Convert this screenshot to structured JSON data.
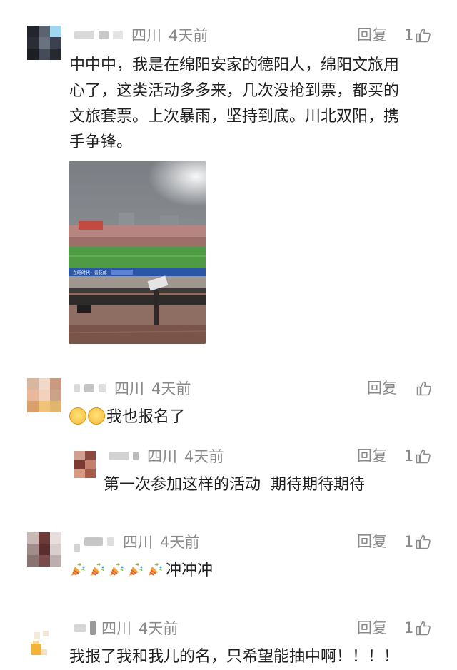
{
  "comments": [
    {
      "location": "四川",
      "time": "4天前",
      "reply_label": "回复",
      "like_count": "1",
      "text_lines": [
        "中中中，我是在绵阳安家的德阳人，绵阳文旅用",
        "心了，这类活动多多来，几次没抢到票，都买的",
        "文旅套票。上次暴雨，坚持到底。川北双阳，携",
        "手争锋。"
      ]
    },
    {
      "location": "四川",
      "time": "4天前",
      "reply_label": "回复",
      "like_count": "",
      "text": "我也报名了"
    },
    {
      "location": "四川",
      "time": "4天前",
      "reply_label": "回复",
      "like_count": "1",
      "text": "第一次参加这样的活动  期待期待期待"
    },
    {
      "location": "四川",
      "time": "4天前",
      "reply_label": "回复",
      "like_count": "1",
      "text": "冲冲冲"
    },
    {
      "location": "四川",
      "time": "4天前",
      "reply_label": "回复",
      "like_count": "1",
      "text": "我报了我和我儿的名，只希望能抽中啊！！！！"
    }
  ],
  "photo": {
    "banner_text": "东旺时代 · 青花郎"
  },
  "icons": {
    "like": "thumbs-up-icon",
    "smile": "smile-emoji-icon",
    "party": "party-popper-emoji-icon"
  }
}
